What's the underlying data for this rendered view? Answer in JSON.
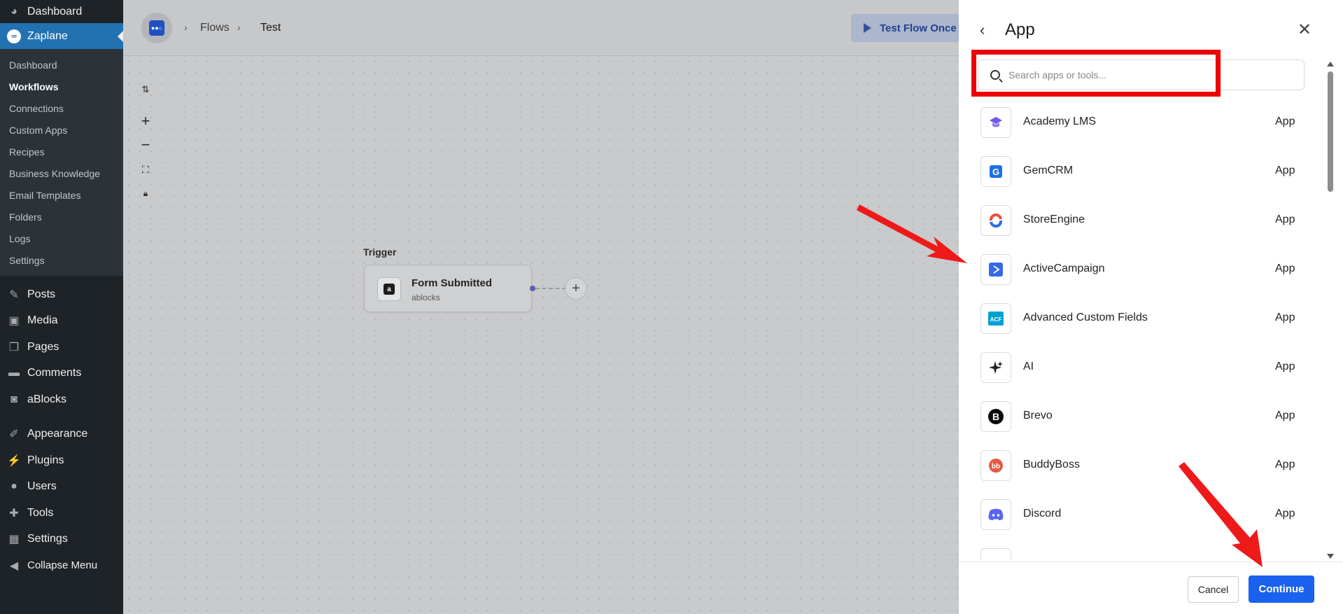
{
  "wp_menu": {
    "dashboard": "Dashboard",
    "plugin_name": "Zaplane",
    "submenu": [
      "Dashboard",
      "Workflows",
      "Connections",
      "Custom Apps",
      "Recipes",
      "Business Knowledge",
      "Email Templates",
      "Folders",
      "Logs",
      "Settings"
    ],
    "active_submenu": "Workflows",
    "items": [
      "Posts",
      "Media",
      "Pages",
      "Comments",
      "aBlocks",
      "Appearance",
      "Plugins",
      "Users",
      "Tools",
      "Settings",
      "Collapse Menu"
    ]
  },
  "builder": {
    "breadcrumb": [
      "Flows",
      "Test"
    ],
    "test_button": "Test Flow Once",
    "trigger_label": "Trigger",
    "node_title": "Form Submitted",
    "node_subtitle": "ablocks"
  },
  "drawer": {
    "title": "App",
    "search_placeholder": "Search apps or tools...",
    "apps": [
      {
        "name": "Academy LMS",
        "type": "App",
        "icon": "academy-lms-icon",
        "color": "#6c5ce7"
      },
      {
        "name": "GemCRM",
        "type": "App",
        "icon": "gemcrm-icon",
        "color": "#1f6fe5"
      },
      {
        "name": "StoreEngine",
        "type": "App",
        "icon": "storeengine-icon",
        "color": "#f24d3d"
      },
      {
        "name": "ActiveCampaign",
        "type": "App",
        "icon": "activecampaign-icon",
        "color": "#356ae6"
      },
      {
        "name": "Advanced Custom Fields",
        "type": "App",
        "icon": "acf-icon",
        "color": "#00a0d2"
      },
      {
        "name": "AI",
        "type": "App",
        "icon": "sparkle-icon",
        "color": "#222222"
      },
      {
        "name": "Brevo",
        "type": "App",
        "icon": "brevo-icon",
        "color": "#0b0b0b"
      },
      {
        "name": "BuddyBoss",
        "type": "App",
        "icon": "buddyboss-icon",
        "color": "#e25b45"
      },
      {
        "name": "Discord",
        "type": "App",
        "icon": "discord-icon",
        "color": "#5865f2"
      }
    ],
    "cancel": "Cancel",
    "continue": "Continue"
  },
  "colors": {
    "accent": "#1a62ee",
    "highlight": "#ee0000",
    "wp_sidebar": "#1d2327",
    "wp_active": "#2271b1"
  }
}
